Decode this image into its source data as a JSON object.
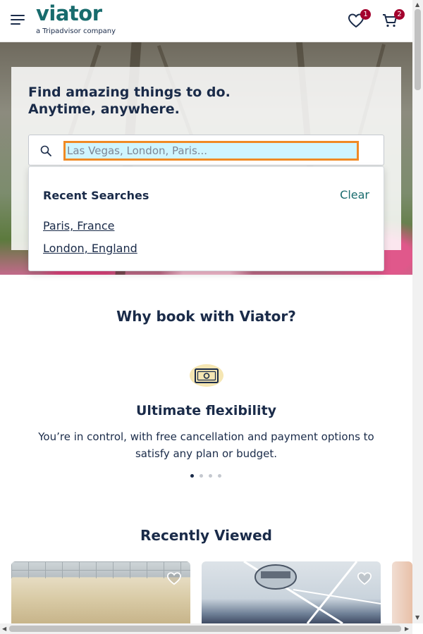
{
  "header": {
    "logo_text": "viator",
    "logo_sub": "a Tripadvisor company",
    "wishlist_count": "1",
    "cart_count": "2"
  },
  "hero": {
    "title": "Find amazing things to do.\nAnytime, anywhere."
  },
  "search": {
    "placeholder": "Las Vegas, London, Paris..."
  },
  "recent_searches": {
    "title": "Recent Searches",
    "clear_label": "Clear",
    "items": [
      "Paris, France",
      "London, England"
    ]
  },
  "why_book": {
    "title": "Why book with Viator?",
    "feature_title": "Ultimate flexibility",
    "feature_text": "You’re in control, with free cancellation and payment options to satisfy any plan or budget.",
    "carousel_count": 4,
    "carousel_active": 1
  },
  "recently_viewed": {
    "title": "Recently Viewed"
  },
  "colors": {
    "brand": "#186b6d",
    "text": "#1a2b49",
    "badge": "#a3002d",
    "focus_ring": "#f08a24"
  }
}
